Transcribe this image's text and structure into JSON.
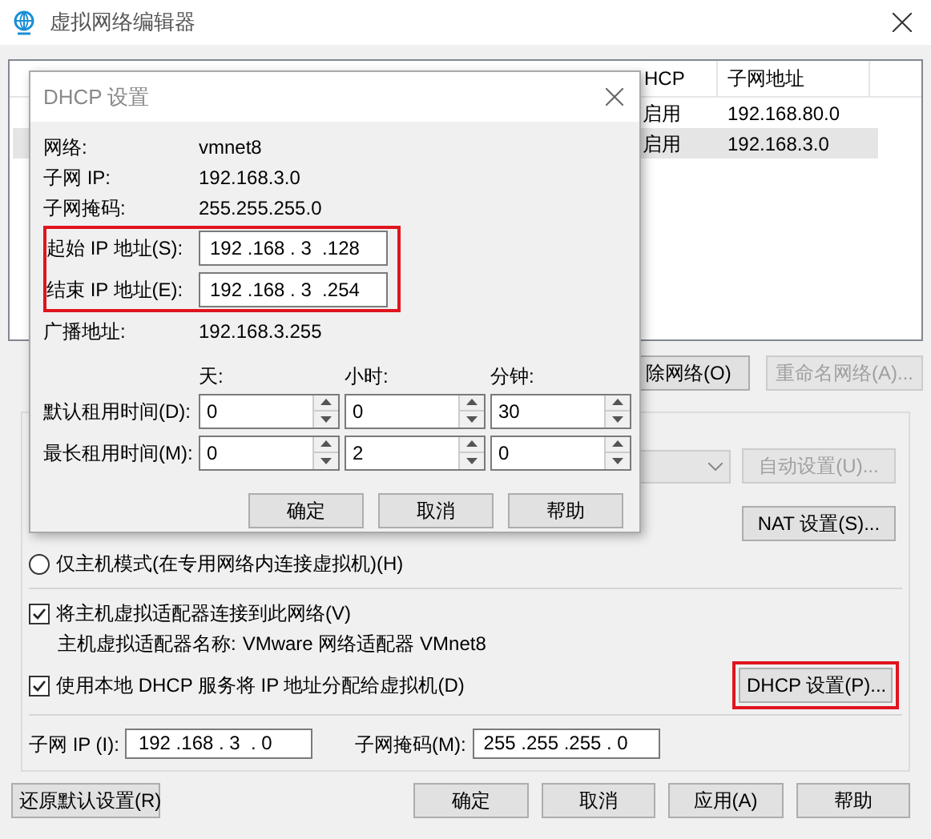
{
  "window": {
    "title": "虚拟网络编辑器"
  },
  "table": {
    "columns": [
      "HCP",
      "子网地址"
    ],
    "rows": [
      {
        "dhcp": "启用",
        "subnet": "192.168.80.0",
        "selected": false
      },
      {
        "dhcp": "启用",
        "subnet": "192.168.3.0",
        "selected": true
      }
    ]
  },
  "table_buttons": [
    {
      "label": "除网络(O)",
      "disabled": false
    },
    {
      "label": "重命名网络(A)...",
      "disabled": true
    }
  ],
  "settings": {
    "auto_button": {
      "label": "自动设置(U)...",
      "disabled": true
    },
    "nat_button": {
      "label": "NAT 设置(S)...",
      "disabled": false
    },
    "host_only": {
      "label": "仅主机模式(在专用网络内连接虚拟机)(H)",
      "selected": false
    },
    "connect_adapter": {
      "label": "将主机虚拟适配器连接到此网络(V)",
      "checked": true
    },
    "adapter_name": {
      "label": "主机虚拟适配器名称:",
      "value": "VMware 网络适配器 VMnet8"
    },
    "use_dhcp": {
      "label": "使用本地 DHCP 服务将 IP 地址分配给虚拟机(D)",
      "checked": true
    },
    "dhcp_button": {
      "label": "DHCP 设置(P)...",
      "highlighted": true
    },
    "subnet_ip": {
      "label": "子网 IP (I):",
      "value": "192 .168 . 3  . 0"
    },
    "subnet_mask": {
      "label": "子网掩码(M):",
      "value": "255 .255 .255 . 0"
    }
  },
  "footer_buttons": [
    {
      "label": "还原默认设置(R)"
    },
    {
      "label": "确定"
    },
    {
      "label": "取消"
    },
    {
      "label": "应用(A)"
    },
    {
      "label": "帮助"
    }
  ],
  "dialog": {
    "title": "DHCP 设置",
    "info": [
      {
        "label": "网络:",
        "value": "vmnet8"
      },
      {
        "label": "子网 IP:",
        "value": "192.168.3.0"
      },
      {
        "label": "子网掩码:",
        "value": "255.255.255.0"
      }
    ],
    "range_highlighted": true,
    "range": [
      {
        "label": "起始 IP 地址(S):",
        "value": "192 .168 . 3  .128"
      },
      {
        "label": "结束 IP 地址(E):",
        "value": "192 .168 . 3  .254"
      }
    ],
    "broadcast": {
      "label": "广播地址:",
      "value": "192.168.3.255"
    },
    "lease_headers": [
      "天:",
      "小时:",
      "分钟:"
    ],
    "leases": [
      {
        "label": "默认租用时间(D):",
        "values": [
          "0",
          "0",
          "30"
        ]
      },
      {
        "label": "最长租用时间(M):",
        "values": [
          "0",
          "2",
          "0"
        ]
      }
    ],
    "buttons": [
      "确定",
      "取消",
      "帮助"
    ]
  }
}
